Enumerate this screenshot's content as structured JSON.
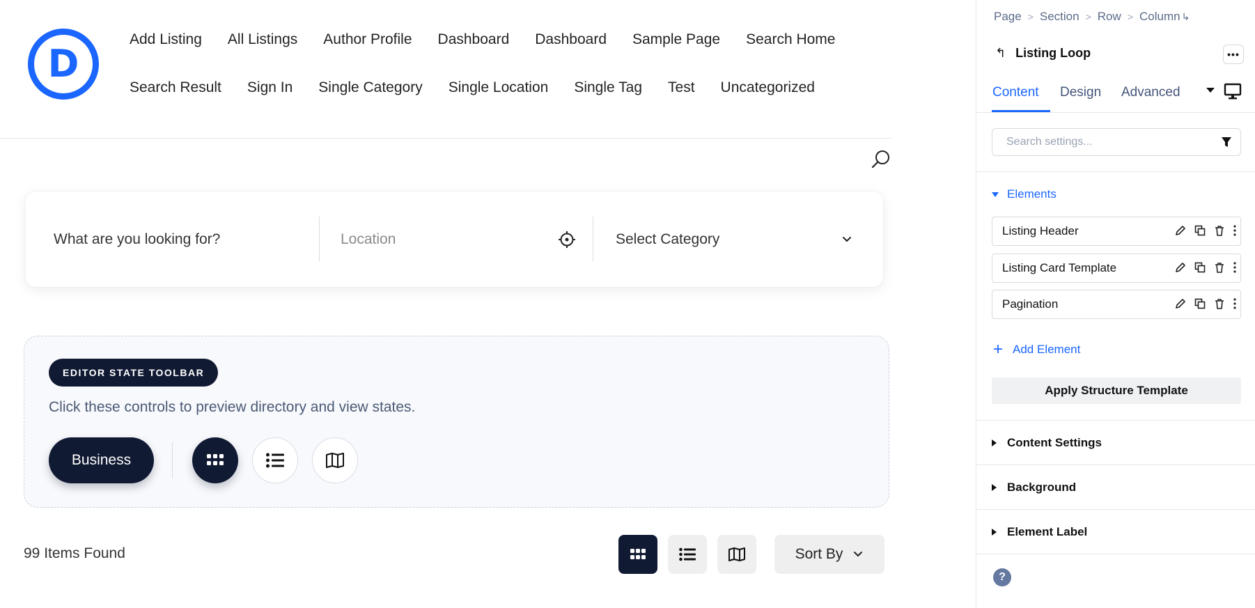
{
  "logo": {
    "letter": "D",
    "color": "#1a66ff"
  },
  "nav": {
    "row1": [
      "Add Listing",
      "All Listings",
      "Author Profile",
      "Dashboard",
      "Dashboard",
      "Sample Page",
      "Search Home"
    ],
    "row2": [
      "Search Result",
      "Sign In",
      "Single Category",
      "Single Location",
      "Single Tag",
      "Test",
      "Uncategorized"
    ]
  },
  "search_form": {
    "what_placeholder": "What are you looking for?",
    "location_placeholder": "Location",
    "category_value": "Select Category"
  },
  "editor_toolbar": {
    "badge": "EDITOR STATE TOOLBAR",
    "description": "Click these controls to preview directory and view states.",
    "business_label": "Business"
  },
  "results": {
    "count_text": "99 Items Found",
    "sort_label": "Sort By"
  },
  "panel": {
    "breadcrumb": [
      "Page",
      "Section",
      "Row",
      "Column"
    ],
    "module_title": "Listing Loop",
    "tabs": [
      "Content",
      "Design",
      "Advanced"
    ],
    "search_placeholder": "Search settings...",
    "elements_label": "Elements",
    "elements": [
      "Listing Header",
      "Listing Card Template",
      "Pagination"
    ],
    "add_element_label": "Add Element",
    "apply_template_label": "Apply Structure Template",
    "sections": [
      "Content Settings",
      "Background",
      "Element Label"
    ]
  },
  "colors": {
    "accent": "#1a66ff",
    "dark": "#111a33",
    "muted": "#5b6b8a"
  },
  "icons": [
    "search-icon",
    "crosshair-icon",
    "chevron-down-icon",
    "grid-icon",
    "list-icon",
    "map-icon",
    "back-arrow-icon",
    "more-icon",
    "desktop-icon",
    "filter-icon",
    "edit-icon",
    "duplicate-icon",
    "trash-icon",
    "kebab-icon",
    "help-icon"
  ]
}
